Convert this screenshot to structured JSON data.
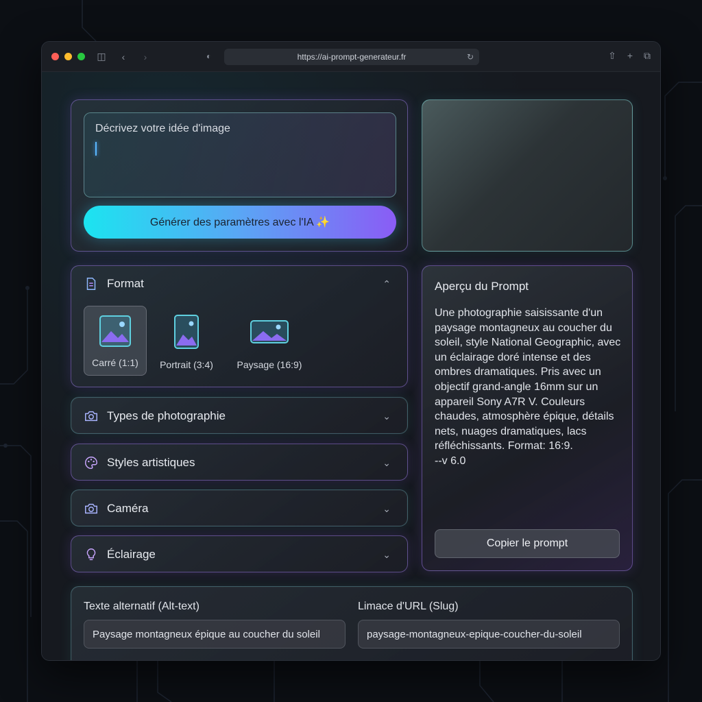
{
  "browser": {
    "url": "https://ai-prompt-generateur.fr",
    "colors": {
      "close": "#ff5f57",
      "minimize": "#febc2e",
      "zoom": "#28c840"
    }
  },
  "prompt_input": {
    "placeholder": "Décrivez votre idée d'image"
  },
  "generate_button": {
    "label": "Générer des paramètres avec l'IA ✨"
  },
  "format": {
    "title": "Format",
    "options": [
      {
        "label": "Carré (1:1)",
        "selected": true
      },
      {
        "label": "Portrait (3:4)",
        "selected": false
      },
      {
        "label": "Paysage (16:9)",
        "selected": false
      }
    ]
  },
  "accordions": [
    {
      "title": "Types de photographie",
      "icon": "camera-icon"
    },
    {
      "title": "Styles artistiques",
      "icon": "palette-icon"
    },
    {
      "title": "Caméra",
      "icon": "camera-icon"
    },
    {
      "title": "Éclairage",
      "icon": "lightbulb-icon"
    }
  ],
  "summary": {
    "title": "Aperçu du Prompt",
    "text": "Une photographie saisissante d'un paysage montagneux au coucher du soleil, style National Geographic, avec un éclairage doré intense et des ombres dramatiques. Pris avec un objectif grand-angle 16mm sur un appareil Sony A7R V. Couleurs chaudes, atmosphère épique, détails nets, nuages dramatiques, lacs réfléchissants. Format: 16:9.",
    "version": "--v 6.0",
    "copy_label": "Copier le prompt"
  },
  "meta": {
    "alt_label": "Texte alternatif (Alt-text)",
    "alt_value": "Paysage montagneux épique au coucher du soleil",
    "slug_label": "Limace d'URL (Slug)",
    "slug_value": "paysage-montagneux-epique-coucher-du-soleil"
  },
  "accent": {
    "cyan": "#1be4f0",
    "purple": "#8a5cf5"
  }
}
